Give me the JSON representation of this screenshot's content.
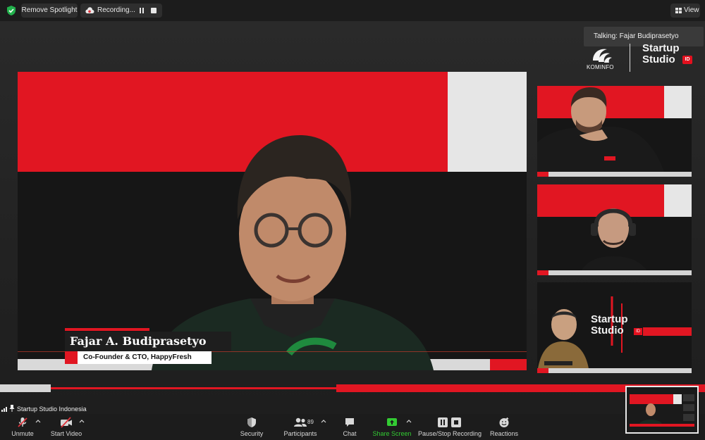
{
  "topbar": {
    "remove_spotlight": "Remove Spotlight",
    "recording_label": "Recording...",
    "view_label": "View"
  },
  "talking": "Talking: Fajar Budiprasetyo",
  "branding": {
    "kominfo": "KOMINFO",
    "startup": "Startup",
    "studio": "Studio",
    "id": "ID"
  },
  "lower_third": {
    "name": "Fajar A. Budiprasetyo",
    "role": "Co-Founder & CTO, HappyFresh"
  },
  "thumb3_branding": {
    "startup": "Startup",
    "studio": "Studio",
    "id": "ID"
  },
  "meeting": {
    "name": "Startup Studio Indonesia"
  },
  "toolbar": {
    "unmute": "Unmute",
    "start_video": "Start Video",
    "security": "Security",
    "participants": "Participants",
    "participant_count": "89",
    "chat": "Chat",
    "share_screen": "Share Screen",
    "pause_stop_recording": "Pause/Stop Recording",
    "reactions": "Reactions"
  },
  "colors": {
    "brand_red": "#e11622",
    "share_green": "#33cc33",
    "toolbar_bg": "#1c1c1c"
  }
}
